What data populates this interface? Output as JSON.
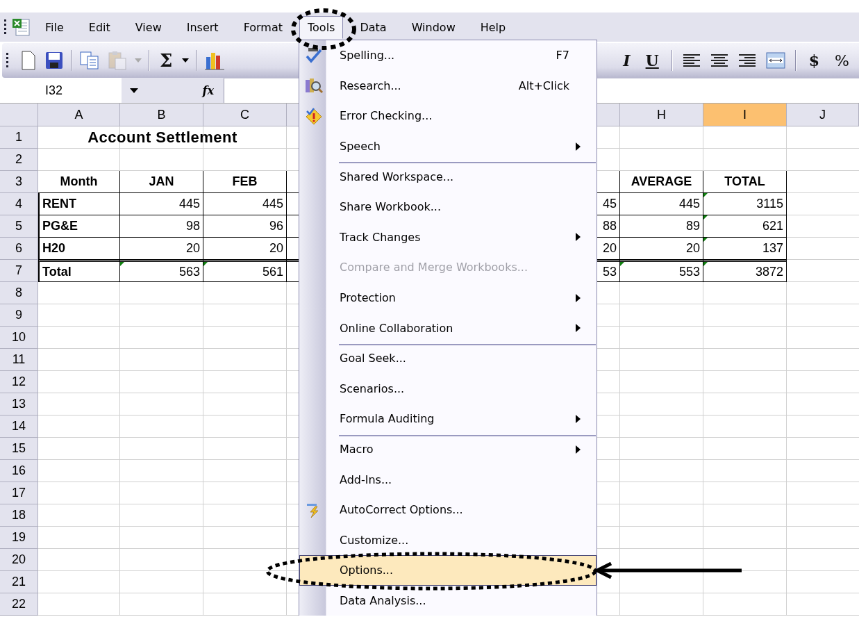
{
  "menu_bar": [
    {
      "label": "File",
      "selected": false
    },
    {
      "label": "Edit",
      "selected": false
    },
    {
      "label": "View",
      "selected": false
    },
    {
      "label": "Insert",
      "selected": false
    },
    {
      "label": "Format",
      "selected": false
    },
    {
      "label": "Tools",
      "selected": true
    },
    {
      "label": "Data",
      "selected": false
    },
    {
      "label": "Window",
      "selected": false
    },
    {
      "label": "Help",
      "selected": false
    }
  ],
  "toolbar_left": [
    {
      "kind": "new",
      "disabled": false
    },
    {
      "kind": "save",
      "disabled": false
    },
    {
      "kind": "sep"
    },
    {
      "kind": "copy",
      "disabled": false
    },
    {
      "kind": "paste",
      "disabled": true
    },
    {
      "kind": "drop",
      "disabled": true
    },
    {
      "kind": "sep"
    },
    {
      "kind": "glyph",
      "label": "Σ",
      "disabled": false
    },
    {
      "kind": "drop",
      "disabled": false
    },
    {
      "kind": "sep"
    },
    {
      "kind": "chart",
      "disabled": false
    }
  ],
  "toolbar_right": [
    {
      "kind": "italic",
      "label": "I"
    },
    {
      "kind": "underline",
      "label": "U"
    },
    {
      "kind": "sep"
    },
    {
      "kind": "align_left"
    },
    {
      "kind": "align_center"
    },
    {
      "kind": "align_right"
    },
    {
      "kind": "merge"
    },
    {
      "kind": "sep"
    },
    {
      "kind": "currency",
      "label": "$"
    },
    {
      "kind": "percent",
      "label": "%"
    }
  ],
  "formula_bar": {
    "name_box": "I32",
    "fx": "fx"
  },
  "columns_left": [
    {
      "letter": "A",
      "selected": false
    },
    {
      "letter": "B",
      "selected": false
    },
    {
      "letter": "C",
      "selected": false
    }
  ],
  "columns_right": [
    {
      "letter": "H",
      "selected": false
    },
    {
      "letter": "I",
      "selected": true
    },
    {
      "letter": "J",
      "selected": false
    }
  ],
  "rows": [
    {
      "num": "1",
      "kind": "title",
      "title": "Account Settlement"
    },
    {
      "num": "2",
      "kind": "blank"
    },
    {
      "num": "3",
      "kind": "header",
      "left": [
        {
          "text": "Month"
        },
        {
          "text": "JAN"
        },
        {
          "text": "FEB"
        }
      ],
      "right": [
        {
          "text": "AVERAGE"
        },
        {
          "text": "TOTAL"
        }
      ]
    },
    {
      "num": "4",
      "kind": "data",
      "left": [
        {
          "text": "RENT",
          "flagged": false
        },
        {
          "text": "445",
          "flagged": false
        },
        {
          "text": "445",
          "flagged": false
        }
      ],
      "edge": "45",
      "right": [
        {
          "text": "445",
          "flagged": false
        },
        {
          "text": "3115",
          "flagged": true
        }
      ]
    },
    {
      "num": "5",
      "kind": "data",
      "left": [
        {
          "text": "PG&E",
          "flagged": false
        },
        {
          "text": "98",
          "flagged": false
        },
        {
          "text": "96",
          "flagged": false
        }
      ],
      "edge": "88",
      "right": [
        {
          "text": "89",
          "flagged": false
        },
        {
          "text": "621",
          "flagged": true
        }
      ]
    },
    {
      "num": "6",
      "kind": "data",
      "left": [
        {
          "text": "H20",
          "flagged": false
        },
        {
          "text": "20",
          "flagged": false
        },
        {
          "text": "20",
          "flagged": false
        }
      ],
      "edge": "20",
      "right": [
        {
          "text": "20",
          "flagged": false
        },
        {
          "text": "137",
          "flagged": true
        }
      ]
    },
    {
      "num": "7",
      "kind": "total",
      "left": [
        {
          "text": "Total",
          "flagged": false
        },
        {
          "text": "563",
          "flagged": true
        },
        {
          "text": "561",
          "flagged": true
        }
      ],
      "edge": "53",
      "right": [
        {
          "text": "553",
          "flagged": true
        },
        {
          "text": "3872",
          "flagged": true
        }
      ]
    },
    {
      "num": "8",
      "kind": "blank"
    },
    {
      "num": "9",
      "kind": "blank"
    },
    {
      "num": "10",
      "kind": "blank"
    },
    {
      "num": "11",
      "kind": "blank"
    },
    {
      "num": "12",
      "kind": "blank"
    },
    {
      "num": "13",
      "kind": "blank"
    },
    {
      "num": "14",
      "kind": "blank"
    },
    {
      "num": "15",
      "kind": "blank"
    },
    {
      "num": "16",
      "kind": "blank"
    },
    {
      "num": "17",
      "kind": "blank"
    },
    {
      "num": "18",
      "kind": "blank"
    },
    {
      "num": "19",
      "kind": "blank"
    },
    {
      "num": "20",
      "kind": "blank"
    },
    {
      "num": "21",
      "kind": "blank"
    },
    {
      "num": "22",
      "kind": "blank"
    }
  ],
  "tools_menu": [
    {
      "label": "Spelling...",
      "shortcut": "F7",
      "kind": "spelling",
      "submenu": false,
      "disabled": false,
      "selected": false,
      "separator_before": false
    },
    {
      "label": "Research...",
      "shortcut": "Alt+Click",
      "kind": "research",
      "submenu": false,
      "disabled": false,
      "selected": false,
      "separator_before": false
    },
    {
      "label": "Error Checking...",
      "kind": "error",
      "submenu": false,
      "disabled": false,
      "selected": false,
      "separator_before": false
    },
    {
      "label": "Speech",
      "submenu": true,
      "disabled": false,
      "selected": false,
      "separator_before": false
    },
    {
      "label": "Shared Workspace...",
      "submenu": false,
      "disabled": false,
      "selected": false,
      "separator_before": true
    },
    {
      "label": "Share Workbook...",
      "submenu": false,
      "disabled": false,
      "selected": false,
      "separator_before": false
    },
    {
      "label": "Track Changes",
      "submenu": true,
      "disabled": false,
      "selected": false,
      "separator_before": false
    },
    {
      "label": "Compare and Merge Workbooks...",
      "submenu": false,
      "disabled": true,
      "selected": false,
      "separator_before": false
    },
    {
      "label": "Protection",
      "submenu": true,
      "disabled": false,
      "selected": false,
      "separator_before": false
    },
    {
      "label": "Online Collaboration",
      "submenu": true,
      "disabled": false,
      "selected": false,
      "separator_before": false
    },
    {
      "label": "Goal Seek...",
      "submenu": false,
      "disabled": false,
      "selected": false,
      "separator_before": true
    },
    {
      "label": "Scenarios...",
      "submenu": false,
      "disabled": false,
      "selected": false,
      "separator_before": false
    },
    {
      "label": "Formula Auditing",
      "submenu": true,
      "disabled": false,
      "selected": false,
      "separator_before": false
    },
    {
      "label": "Macro",
      "submenu": true,
      "disabled": false,
      "selected": false,
      "separator_before": true
    },
    {
      "label": "Add-Ins...",
      "submenu": false,
      "disabled": false,
      "selected": false,
      "separator_before": false
    },
    {
      "label": "AutoCorrect Options...",
      "kind": "autocorrect",
      "submenu": false,
      "disabled": false,
      "selected": false,
      "separator_before": false
    },
    {
      "label": "Customize...",
      "submenu": false,
      "disabled": false,
      "selected": false,
      "separator_before": false
    },
    {
      "label": "Options...",
      "submenu": false,
      "disabled": false,
      "selected": true,
      "separator_before": false
    },
    {
      "label": "Data Analysis...",
      "submenu": false,
      "disabled": false,
      "selected": false,
      "separator_before": false
    }
  ],
  "annotations": [
    {
      "kind": "menu_ring"
    },
    {
      "kind": "item_ring"
    },
    {
      "kind": "pointer"
    }
  ]
}
